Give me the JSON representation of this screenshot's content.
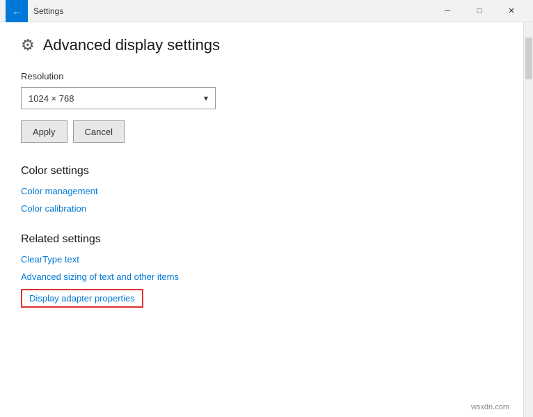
{
  "titlebar": {
    "back_icon": "←",
    "title": "Settings",
    "minimize_icon": "─",
    "maximize_icon": "□",
    "close_icon": "✕"
  },
  "page": {
    "header_icon": "⚙",
    "header_title": "Advanced display settings"
  },
  "resolution_section": {
    "label": "Resolution",
    "selected_value": "1024 × 768",
    "dropdown_arrow": "▾"
  },
  "buttons": {
    "apply_label": "Apply",
    "cancel_label": "Cancel"
  },
  "color_settings": {
    "title": "Color settings",
    "links": [
      {
        "label": "Color management"
      },
      {
        "label": "Color calibration"
      }
    ]
  },
  "related_settings": {
    "title": "Related settings",
    "links": [
      {
        "label": "ClearType text",
        "highlighted": false
      },
      {
        "label": "Advanced sizing of text and other items",
        "highlighted": false
      },
      {
        "label": "Display adapter properties",
        "highlighted": true
      }
    ]
  },
  "watermark": {
    "text": "wsxdn.com"
  }
}
